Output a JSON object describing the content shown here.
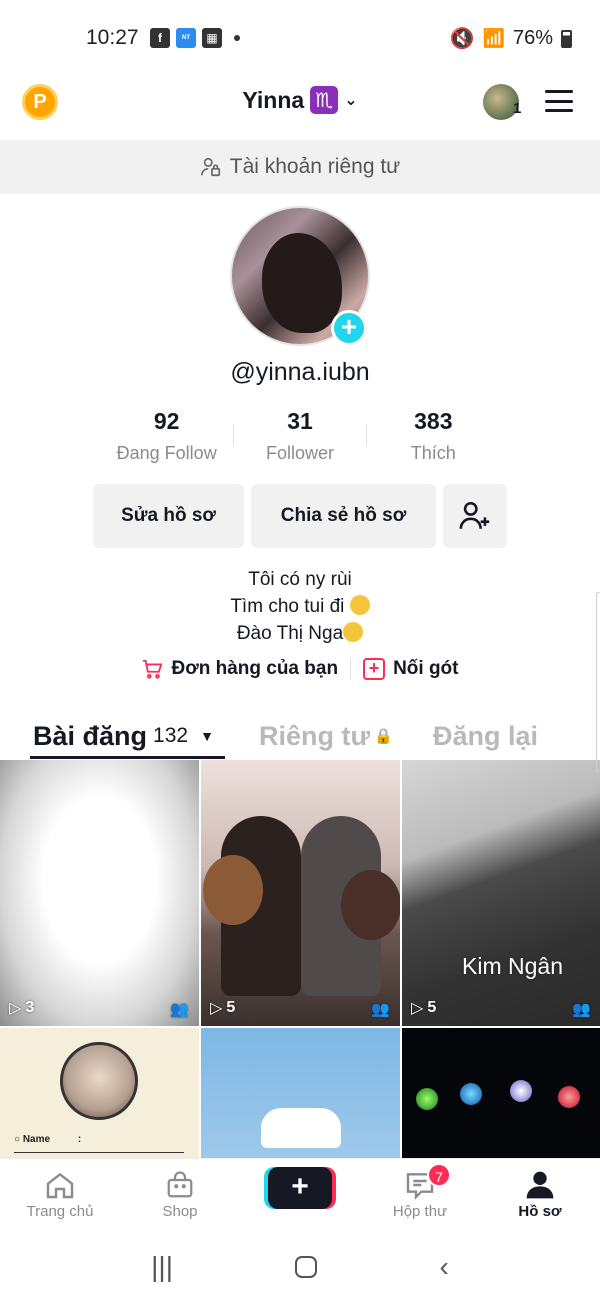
{
  "status_bar": {
    "time": "10:27",
    "battery": "76%",
    "icons": [
      "facebook-icon",
      "novel-toon-icon",
      "app-icon",
      "dot"
    ],
    "right_icons": [
      "mute-icon",
      "wifi-icon",
      "signal-icon",
      "battery-icon"
    ]
  },
  "header": {
    "coin_label": "P",
    "username": "Yinna",
    "zodiac": "♏",
    "avatar_count": "1"
  },
  "private_banner": {
    "text": "Tài khoản riêng tư"
  },
  "profile": {
    "handle": "@yinna.iubn",
    "stats": [
      {
        "value": "92",
        "label": "Đang Follow"
      },
      {
        "value": "31",
        "label": "Follower"
      },
      {
        "value": "383",
        "label": "Thích"
      }
    ],
    "edit_button": "Sửa hồ sơ",
    "share_button": "Chia sẻ hồ sơ",
    "bio_lines": [
      "Tôi có ny rùi",
      "Tìm cho tui đi",
      "Đào Thị Nga"
    ],
    "links": [
      {
        "label": "Đơn hàng của bạn"
      },
      {
        "label": "Nối gót"
      }
    ]
  },
  "tabs": {
    "posts_label": "Bài đăng",
    "posts_count": "132",
    "private_label": "Riêng tư",
    "repost_label": "Đăng lại"
  },
  "videos": [
    {
      "plays": "3",
      "caption": ""
    },
    {
      "plays": "5",
      "caption": ""
    },
    {
      "plays": "5",
      "caption": "Kim Ngân"
    },
    {
      "plays": "",
      "caption": "Name"
    },
    {
      "plays": "",
      "caption": ""
    },
    {
      "plays": "",
      "caption": ""
    }
  ],
  "bottom_nav": {
    "home": "Trang chủ",
    "shop": "Shop",
    "inbox": "Hộp thư",
    "inbox_badge": "7",
    "profile": "Hồ sơ"
  },
  "colors": {
    "accent_red": "#fe2c55",
    "accent_cyan": "#20d5ec",
    "text": "#161823",
    "muted": "#8a8b91"
  }
}
